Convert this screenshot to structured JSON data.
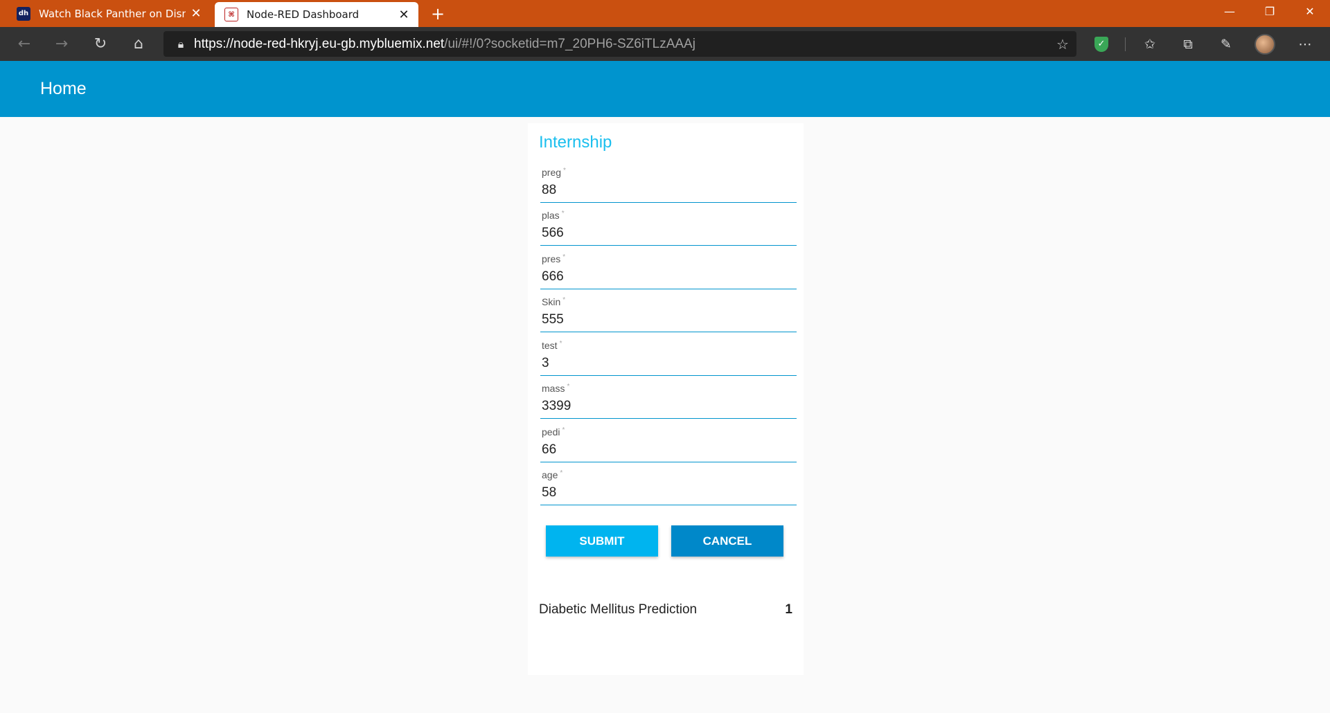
{
  "browser": {
    "tabs": [
      {
        "title": "Watch Black Panther on Disney+",
        "favicon": "dh"
      },
      {
        "title": "Node-RED Dashboard",
        "favicon": "node-red"
      }
    ],
    "url_host": "https://node-red-hkryj.eu-gb.mybluemix.net",
    "url_path": "/ui/#!/0?socketid=m7_20PH6-SZ6iTLzAAAj"
  },
  "header": {
    "title": "Home"
  },
  "form": {
    "title": "Internship",
    "fields": [
      {
        "label": "preg",
        "value": "88"
      },
      {
        "label": "plas",
        "value": "566"
      },
      {
        "label": "pres",
        "value": "666"
      },
      {
        "label": "Skin",
        "value": "555"
      },
      {
        "label": "test",
        "value": "3"
      },
      {
        "label": "mass",
        "value": "3399"
      },
      {
        "label": "pedi",
        "value": "66"
      },
      {
        "label": "age",
        "value": "58"
      }
    ],
    "submit_label": "SUBMIT",
    "cancel_label": "CANCEL"
  },
  "result": {
    "label": "Diabetic Mellitus Prediction",
    "value": "1"
  },
  "colors": {
    "accent": "#0094ce",
    "tabbar": "#ca5010",
    "title": "#1bbfee"
  }
}
